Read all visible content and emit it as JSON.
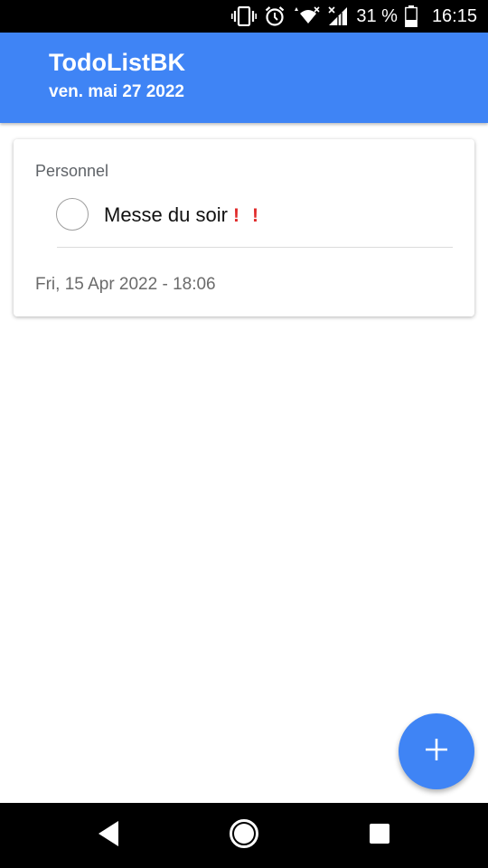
{
  "status_bar": {
    "battery_percent": "31 %",
    "time": "16:15",
    "icons": [
      "vibrate-icon",
      "alarm-icon",
      "wifi-icon",
      "signal-icon",
      "battery-icon"
    ]
  },
  "app_bar": {
    "title": "TodoListBK",
    "date": "ven. mai 27 2022",
    "background_color": "#3f84f5"
  },
  "card": {
    "category": "Personnel",
    "task": {
      "title": "Messe du soir",
      "priority_marks": [
        "!",
        "!"
      ],
      "priority_color": "#e02a2a",
      "completed": false
    },
    "datetime": "Fri, 15 Apr 2022 - 18:06"
  },
  "fab": {
    "icon": "plus-icon",
    "color": "#3f84f5"
  },
  "nav_bar": {
    "buttons": [
      "back-icon",
      "home-icon",
      "recents-icon"
    ]
  }
}
